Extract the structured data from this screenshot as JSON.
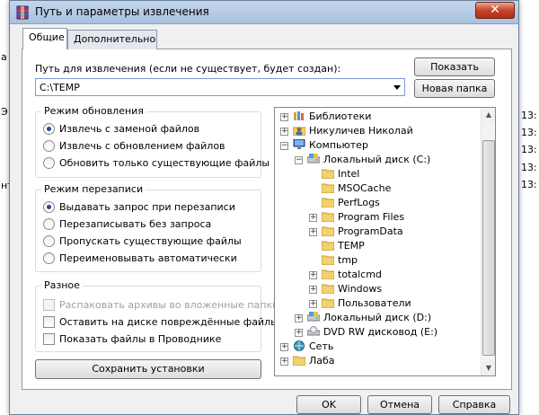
{
  "window": {
    "title": "Путь и параметры извлечения",
    "close_label": "✕"
  },
  "tabs": [
    {
      "label": "Общие",
      "active": true
    },
    {
      "label": "Дополнительно",
      "active": false
    }
  ],
  "path": {
    "label": "Путь для извлечения (если не существует, будет создан):",
    "value": "C:\\TEMP"
  },
  "buttons": {
    "show": "Показать",
    "new_folder": "Новая папка",
    "save_settings": "Сохранить установки",
    "ok": "OK",
    "cancel": "Отмена",
    "help": "Справка"
  },
  "update_mode": {
    "title": "Режим обновления",
    "options": [
      {
        "label": "Извлечь с заменой файлов",
        "selected": true
      },
      {
        "label": "Извлечь с обновлением файлов",
        "selected": false
      },
      {
        "label": "Обновить только существующие файлы",
        "selected": false
      }
    ]
  },
  "overwrite_mode": {
    "title": "Режим перезаписи",
    "options": [
      {
        "label": "Выдавать запрос при перезаписи",
        "selected": true
      },
      {
        "label": "Перезаписывать без запроса",
        "selected": false
      },
      {
        "label": "Пропускать существующие файлы",
        "selected": false
      },
      {
        "label": "Переименовывать автоматически",
        "selected": false
      }
    ]
  },
  "misc": {
    "title": "Разное",
    "options": [
      {
        "label": "Распаковать архивы во вложенные папки",
        "checked": false,
        "disabled": true
      },
      {
        "label": "Оставить на диске повреждённые файлы",
        "checked": false,
        "disabled": false
      },
      {
        "label": "Показать файлы в Проводнике",
        "checked": false,
        "disabled": false
      }
    ]
  },
  "tree": [
    {
      "label": "Библиотеки",
      "level": 0,
      "expander": "+",
      "icon": "library-icon"
    },
    {
      "label": "Никуличев Николай",
      "level": 0,
      "expander": "+",
      "icon": "user-folder-icon"
    },
    {
      "label": "Компьютер",
      "level": 0,
      "expander": "-",
      "icon": "computer-icon"
    },
    {
      "label": "Локальный диск (C:)",
      "level": 1,
      "expander": "-",
      "icon": "drive-icon"
    },
    {
      "label": "Intel",
      "level": 2,
      "expander": "",
      "icon": "folder-icon"
    },
    {
      "label": "MSOCache",
      "level": 2,
      "expander": "",
      "icon": "folder-icon"
    },
    {
      "label": "PerfLogs",
      "level": 2,
      "expander": "",
      "icon": "folder-icon"
    },
    {
      "label": "Program Files",
      "level": 2,
      "expander": "+",
      "icon": "folder-icon"
    },
    {
      "label": "ProgramData",
      "level": 2,
      "expander": "+",
      "icon": "folder-icon"
    },
    {
      "label": "TEMP",
      "level": 2,
      "expander": "",
      "icon": "folder-icon"
    },
    {
      "label": "tmp",
      "level": 2,
      "expander": "",
      "icon": "folder-icon"
    },
    {
      "label": "totalcmd",
      "level": 2,
      "expander": "+",
      "icon": "folder-icon"
    },
    {
      "label": "Windows",
      "level": 2,
      "expander": "+",
      "icon": "folder-icon"
    },
    {
      "label": "Пользователи",
      "level": 2,
      "expander": "+",
      "icon": "folder-icon"
    },
    {
      "label": "Локальный диск (D:)",
      "level": 1,
      "expander": "+",
      "icon": "drive-icon"
    },
    {
      "label": "DVD RW дисковод (E:)",
      "level": 1,
      "expander": "+",
      "icon": "dvd-icon"
    },
    {
      "label": "Сеть",
      "level": 0,
      "expander": "+",
      "icon": "network-icon"
    },
    {
      "label": "Лаба",
      "level": 0,
      "expander": "+",
      "icon": "folder-icon"
    }
  ],
  "background": {
    "left_fragments": [
      "а",
      "Э",
      "нт"
    ],
    "right_fragments": [
      "13:",
      "13:",
      "13:",
      "13:",
      "13:"
    ]
  },
  "colors": {
    "accent": "#2c4b8a",
    "folder": "#e8b93a",
    "close": "#c7432b"
  }
}
